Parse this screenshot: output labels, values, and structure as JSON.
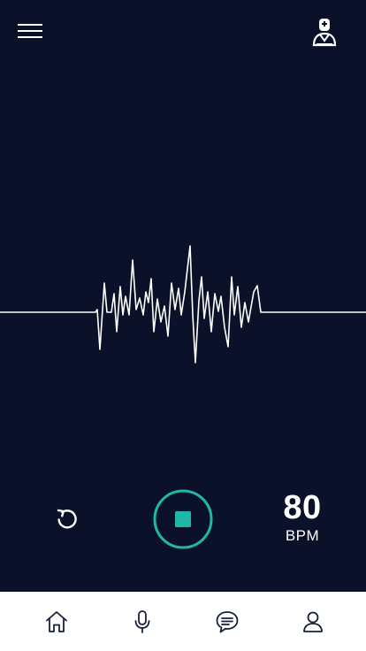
{
  "header": {
    "menu_icon": "hamburger-menu-icon",
    "doctor_icon": "doctor-icon"
  },
  "waveform": {
    "color": "#ffffff"
  },
  "controls": {
    "reset_icon": "reset-icon",
    "stop_icon": "stop-icon",
    "accent_color": "#1fb8a8",
    "bpm_value": "80",
    "bpm_unit": "BPM"
  },
  "bottom_nav": {
    "items": [
      {
        "icon": "home-icon"
      },
      {
        "icon": "microphone-icon"
      },
      {
        "icon": "chat-icon"
      },
      {
        "icon": "profile-icon"
      }
    ]
  },
  "colors": {
    "background": "#0b1129",
    "nav_background": "#ffffff",
    "nav_icon": "#16203d"
  }
}
